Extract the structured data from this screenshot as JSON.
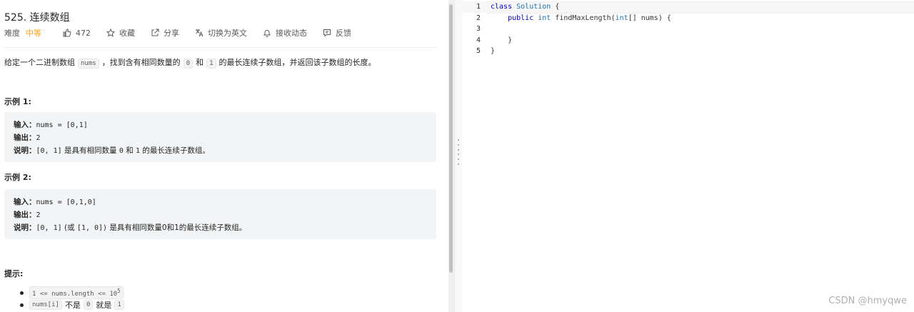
{
  "problem": {
    "title": "525. 连续数组",
    "difficulty_label": "难度",
    "difficulty_value": "中等",
    "likes": "472",
    "favorite_label": "收藏",
    "share_label": "分享",
    "translate_label": "切换为英文",
    "notify_label": "接收动态",
    "feedback_label": "反馈",
    "description_prefix": "给定一个二进制数组",
    "description_code": "nums",
    "description_middle": "，找到含有相同数量的",
    "description_zero": "0",
    "description_and": "和",
    "description_one": "1",
    "description_suffix": "的最长连续子数组，并返回该子数组的长度。"
  },
  "example1": {
    "heading": "示例 1:",
    "input_label": "输入：",
    "input_value": "nums = [0,1]",
    "output_label": "输出：",
    "output_value": "2",
    "explain_label": "说明：",
    "explain_code1": "[0, 1]",
    "explain_text1": "是具有相同数量",
    "explain_code2": "0",
    "explain_text2": "和",
    "explain_code3": "1",
    "explain_text3": "的最长连续子数组。"
  },
  "example2": {
    "heading": "示例 2:",
    "input_label": "输入：",
    "input_value": "nums = [0,1,0]",
    "output_label": "输出：",
    "output_value": "2",
    "explain_label": "说明：",
    "explain_code1": "[0, 1]",
    "explain_text1": "(或",
    "explain_code2": "[1, 0])",
    "explain_text2": "是具有相同数量0和1的最长连续子数组。"
  },
  "hints": {
    "heading": "提示:",
    "item1_code": "1 <= nums.length <= 10",
    "item1_sup": "5",
    "item2_code1": "nums[i]",
    "item2_text1": "不是",
    "item2_code2": "0",
    "item2_text2": "就是",
    "item2_code3": "1"
  },
  "editor": {
    "line_numbers": [
      "1",
      "2",
      "3",
      "4",
      "5"
    ],
    "line1_kw": "class",
    "line1_type": "Solution",
    "line1_rest": " {",
    "line2_indent": "    ",
    "line2_kw": "public",
    "line2_type": "int",
    "line2_rest": " findMaxLength(",
    "line2_type2": "int",
    "line2_rest2": "[] nums) {",
    "line4": "    }",
    "line5": "}"
  },
  "watermark": "CSDN @hmyqwe"
}
